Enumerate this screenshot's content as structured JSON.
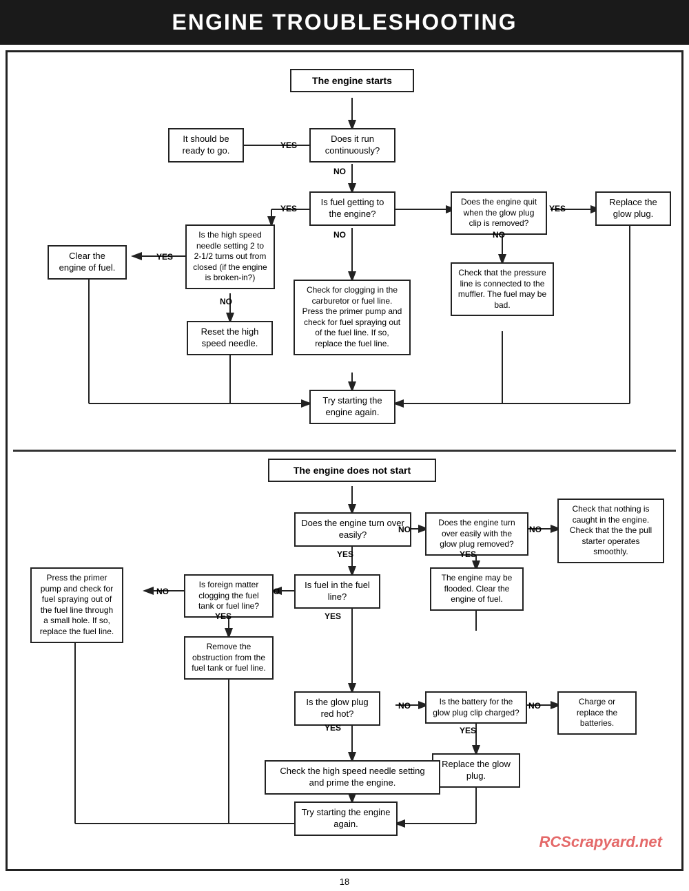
{
  "title": "ENGINE TROUBLESHOOTING",
  "page_number": "18",
  "watermark": "RCScrapyard.net",
  "top": {
    "start_box": "The engine starts",
    "q1": "Does it run continuously?",
    "yes1": "YES",
    "no1": "NO",
    "box_ready": "It should be ready to go.",
    "q2": "Is fuel getting to the engine?",
    "yes2": "YES",
    "no2": "NO",
    "box_high_speed": "Is the high speed needle setting 2 to 2-1/2 turns out from closed (if the engine is broken-in?)",
    "yes3": "YES",
    "no3": "NO",
    "box_clear": "Clear the engine of fuel.",
    "box_reset": "Reset the high speed needle.",
    "box_clog": "Check for clogging in the carburetor or fuel line. Press the primer pump and check for fuel spraying out of the fuel line. If so, replace the fuel line.",
    "q3": "Does the engine quit when the glow plug clip is removed?",
    "yes4": "YES",
    "no4": "NO",
    "box_replace_glow": "Replace the glow plug.",
    "box_pressure": "Check that the pressure line is connected to the muffler. The fuel may be bad.",
    "box_try": "Try starting the engine again."
  },
  "bottom": {
    "start_box": "The engine does not start",
    "q1": "Does the engine turn over easily?",
    "yes1": "YES",
    "no1": "NO",
    "q2": "Does the engine turn over easily with the glow plug removed?",
    "yes2": "YES",
    "no2": "NO",
    "box_caught": "Check that nothing is caught in the engine. Check that the the pull starter operates smoothly.",
    "box_flooded": "The engine may be flooded. Clear the engine of fuel.",
    "q3": "Is fuel in the fuel line?",
    "yes3": "YES",
    "no3": "NO",
    "q4": "Is foreign matter clogging the fuel tank or fuel line?",
    "yes4": "YES",
    "no4": "NO",
    "box_primer": "Press the primer pump and check for fuel spraying out of the fuel line through a small hole. If so, replace the fuel line.",
    "box_remove": "Remove the obstruction from the fuel tank or fuel line.",
    "q5": "Is the glow plug red hot?",
    "yes5": "YES",
    "no5": "NO",
    "q6": "Is the battery for the glow plug clip charged?",
    "yes6": "YES",
    "no6": "NO",
    "box_charge": "Charge or replace the batteries.",
    "box_replace_glow": "Replace the glow plug.",
    "box_high_speed": "Check the high speed needle setting and prime the engine.",
    "box_try": "Try starting the engine again."
  }
}
